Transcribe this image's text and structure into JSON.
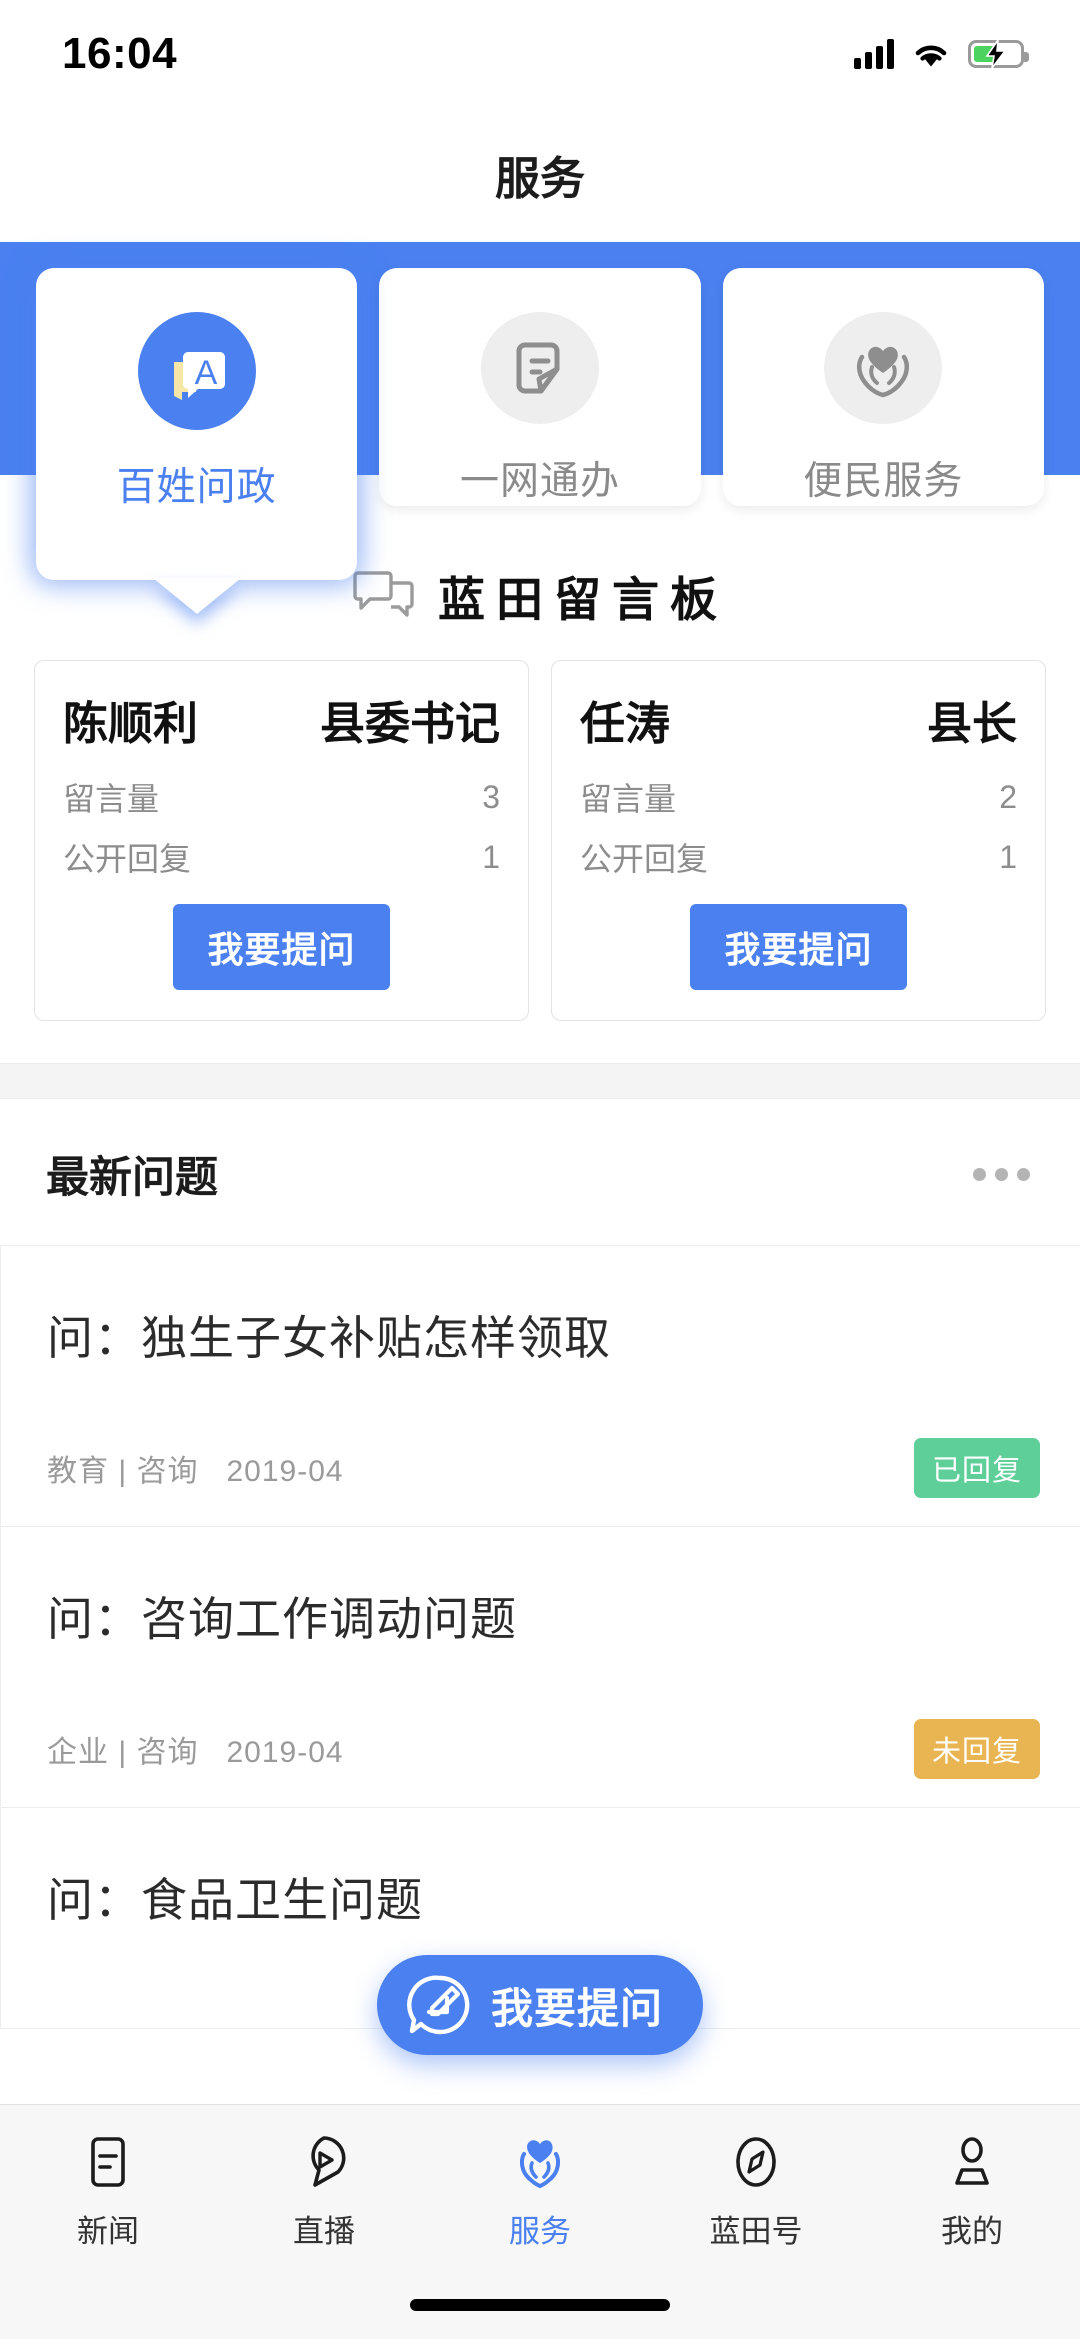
{
  "status_bar": {
    "time": "16:04",
    "signal_icon": "signal-bars-icon",
    "wifi_icon": "wifi-icon",
    "battery_icon": "battery-charging-icon"
  },
  "header": {
    "title": "服务"
  },
  "service_tabs": [
    {
      "label": "百姓问政",
      "icon": "speech-bubble-a-icon",
      "active": true
    },
    {
      "label": "一网通办",
      "icon": "document-pen-icon",
      "active": false
    },
    {
      "label": "便民服务",
      "icon": "hands-heart-icon",
      "active": false
    }
  ],
  "board": {
    "icon": "double-speech-bubble-icon",
    "title": "蓝田留言板"
  },
  "officials": [
    {
      "name": "陈顺利",
      "role": "县委书记",
      "stats": [
        {
          "label": "留言量",
          "value": "3"
        },
        {
          "label": "公开回复",
          "value": "1"
        }
      ],
      "button": "我要提问"
    },
    {
      "name": "任涛",
      "role": "县长",
      "stats": [
        {
          "label": "留言量",
          "value": "2"
        },
        {
          "label": "公开回复",
          "value": "1"
        }
      ],
      "button": "我要提问"
    }
  ],
  "latest": {
    "title": "最新问题",
    "more_icon": "more-dots-icon",
    "questions": [
      {
        "title": "问：独生子女补贴怎样领取",
        "category": "教育 | 咨询",
        "date": "2019-04",
        "status": "已回复",
        "status_type": "replied"
      },
      {
        "title": "问：咨询工作调动问题",
        "category": "企业 | 咨询",
        "date": "2019-04",
        "status": "未回复",
        "status_type": "pending"
      },
      {
        "title": "问：食品卫生问题",
        "category": "",
        "date": "",
        "status": "",
        "status_type": ""
      }
    ]
  },
  "fab": {
    "label": "我要提问",
    "icon": "edit-bubble-icon"
  },
  "bottom_nav": [
    {
      "label": "新闻",
      "icon": "news-document-icon",
      "active": false
    },
    {
      "label": "直播",
      "icon": "live-play-icon",
      "active": false
    },
    {
      "label": "服务",
      "icon": "hands-heart-icon",
      "active": true
    },
    {
      "label": "蓝田号",
      "icon": "compass-icon",
      "active": false
    },
    {
      "label": "我的",
      "icon": "person-icon",
      "active": false
    }
  ],
  "colors": {
    "accent": "#4a80f0",
    "replied_badge": "#5fcf99",
    "pending_badge": "#e8b552",
    "battery_green": "#4cd35f"
  }
}
